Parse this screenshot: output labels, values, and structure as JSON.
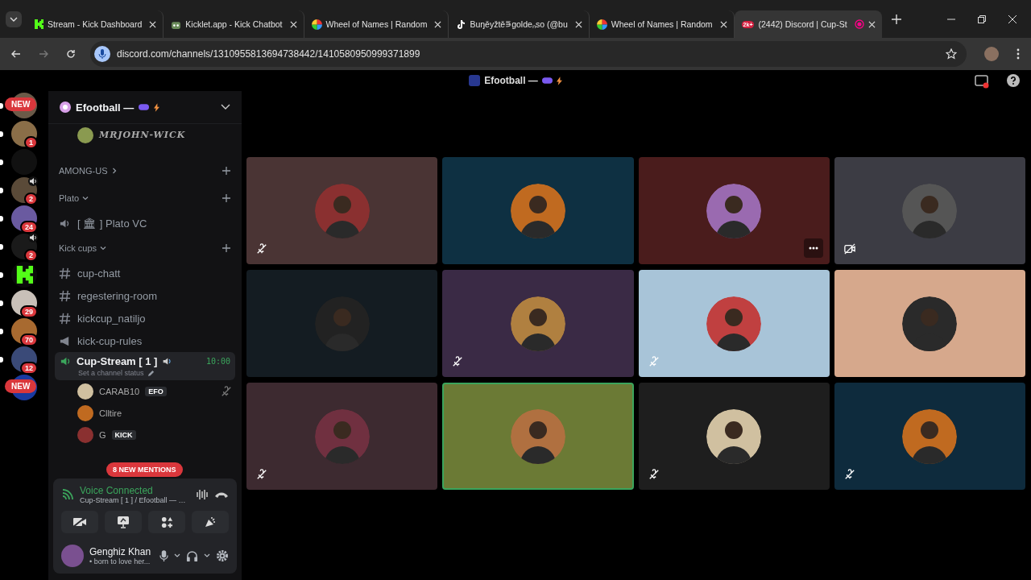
{
  "browser": {
    "tabs": [
      {
        "title": "Stream - Kick Dashboard",
        "kind": "kick",
        "selected": false,
        "recording": false
      },
      {
        "title": "Kicklet.app - Kick Chatbot",
        "kind": "bot",
        "selected": false,
        "recording": false
      },
      {
        "title": "Wheel of Names | Random",
        "kind": "wheel",
        "selected": false,
        "recording": false
      },
      {
        "title": "Buŋěyžtě⋾goldeₙso (@bu",
        "kind": "video",
        "selected": false,
        "recording": false
      },
      {
        "title": "Wheel of Names | Random",
        "kind": "wheel",
        "selected": false,
        "recording": false
      },
      {
        "title": "(2442) Discord | Cup-St",
        "kind": "chat",
        "selected": true,
        "badge": "2k+",
        "recording": true
      }
    ],
    "url": "discord.com/channels/1310955813694738442/1410580950999371899"
  },
  "title_bar": {
    "title": "Efootball —"
  },
  "servers": [
    {
      "color": "#6b5a48",
      "badge": "NEW",
      "unread": true
    },
    {
      "color": "#8a6e48",
      "badge": "1",
      "unread": true
    },
    {
      "color": "#111111",
      "unread": true
    },
    {
      "color": "#5a4a38",
      "badge": "2",
      "voice": true,
      "unread": true
    },
    {
      "color": "#6a5aa0",
      "badge": "24",
      "unread": true
    },
    {
      "color": "#1a1a1a",
      "badge": "2",
      "voice": true,
      "unread": true
    },
    {
      "color": "#0a0a0a",
      "kind": "kick",
      "unread": true
    },
    {
      "color": "#c8c0b8",
      "badge": "29",
      "unread": true
    },
    {
      "color": "#a86a30",
      "badge": "70",
      "unread": true
    },
    {
      "color": "#3a4a78",
      "badge": "12",
      "unread": true
    },
    {
      "color": "#1a3aa0",
      "badge": "NEW",
      "unread": false
    }
  ],
  "server": {
    "name": "Efootball —"
  },
  "channels": [
    {
      "kind": "member",
      "name": "MRJOHN-WICK"
    },
    {
      "kind": "category",
      "name": "AMONG-US",
      "expanded": false
    },
    {
      "kind": "category",
      "name": "Plato",
      "expanded": true
    },
    {
      "kind": "voice",
      "name": "[ 🏛 ] Plato VC"
    },
    {
      "kind": "category",
      "name": "Kick cups",
      "expanded": true
    },
    {
      "kind": "text",
      "name": "cup-chatt"
    },
    {
      "kind": "text",
      "name": "regestering-room"
    },
    {
      "kind": "text",
      "name": "kickcup_natiljo"
    },
    {
      "kind": "announcement",
      "name": "kick-cup-rules"
    },
    {
      "kind": "active-voice",
      "name": "Cup-Stream [ 1 ]",
      "timer": "10:00",
      "status": "Set a channel status"
    },
    {
      "kind": "voice-member",
      "name": "CARAB10",
      "tag": "EFO",
      "muted": true
    },
    {
      "kind": "voice-member",
      "name": "Clltire",
      "muted": false
    },
    {
      "kind": "voice-member",
      "name": "G",
      "tag": "KICK",
      "muted": false
    }
  ],
  "mentions_pill": "8 NEW MENTIONS",
  "voice_panel": {
    "status": "Voice Connected",
    "location": "Cup-Stream [ 1 ] / Efootball — …"
  },
  "user": {
    "name": "Genghiz Khan",
    "status": "• born to love her..."
  },
  "tiles": [
    {
      "color": "#4a3434",
      "muted": true,
      "video_off": false,
      "hovered": false,
      "speaking": false
    },
    {
      "color": "#0e3042",
      "muted": false,
      "video_off": false,
      "hovered": false,
      "speaking": false
    },
    {
      "color": "#4a1c1c",
      "muted": false,
      "video_off": false,
      "hovered": true,
      "speaking": false
    },
    {
      "color": "#3c3c44",
      "muted": false,
      "video_off": true,
      "hovered": false,
      "speaking": false
    },
    {
      "color": "#141c22",
      "muted": false,
      "video_off": false,
      "hovered": false,
      "speaking": false
    },
    {
      "color": "#3a2a45",
      "muted": true,
      "video_off": false,
      "hovered": false,
      "speaking": false
    },
    {
      "color": "#a8c4d8",
      "muted": true,
      "video_off": false,
      "hovered": false,
      "speaking": false
    },
    {
      "color": "#d6a88c",
      "muted": false,
      "video_off": false,
      "hovered": false,
      "speaking": false
    },
    {
      "color": "#3d2a30",
      "muted": true,
      "video_off": false,
      "hovered": false,
      "speaking": false
    },
    {
      "color": "#6b7a35",
      "muted": false,
      "video_off": false,
      "hovered": false,
      "speaking": true
    },
    {
      "color": "#1e1e1e",
      "muted": true,
      "video_off": false,
      "hovered": false,
      "speaking": false
    },
    {
      "color": "#0e2b3d",
      "muted": true,
      "video_off": false,
      "hovered": false,
      "speaking": false
    }
  ]
}
